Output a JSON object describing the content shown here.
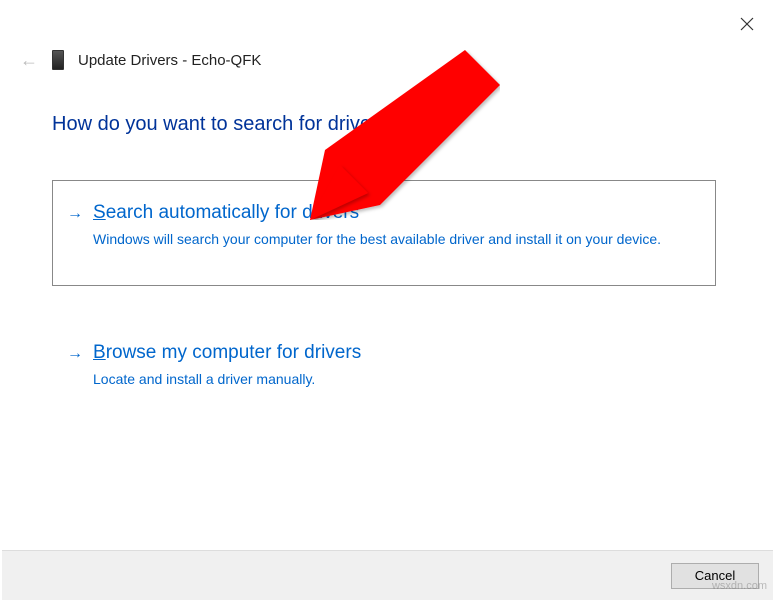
{
  "window": {
    "title": "Update Drivers - Echo-QFK"
  },
  "heading": "How do you want to search for drivers?",
  "options": {
    "auto": {
      "title_pre": "S",
      "title_rest": "earch automatically for drivers",
      "description": "Windows will search your computer for the best available driver and install it on your device."
    },
    "browse": {
      "title_pre": "B",
      "title_rest": "rowse my computer for drivers",
      "description": "Locate and install a driver manually."
    }
  },
  "footer": {
    "cancel_label": "Cancel"
  },
  "watermark": "wsxdn.com"
}
